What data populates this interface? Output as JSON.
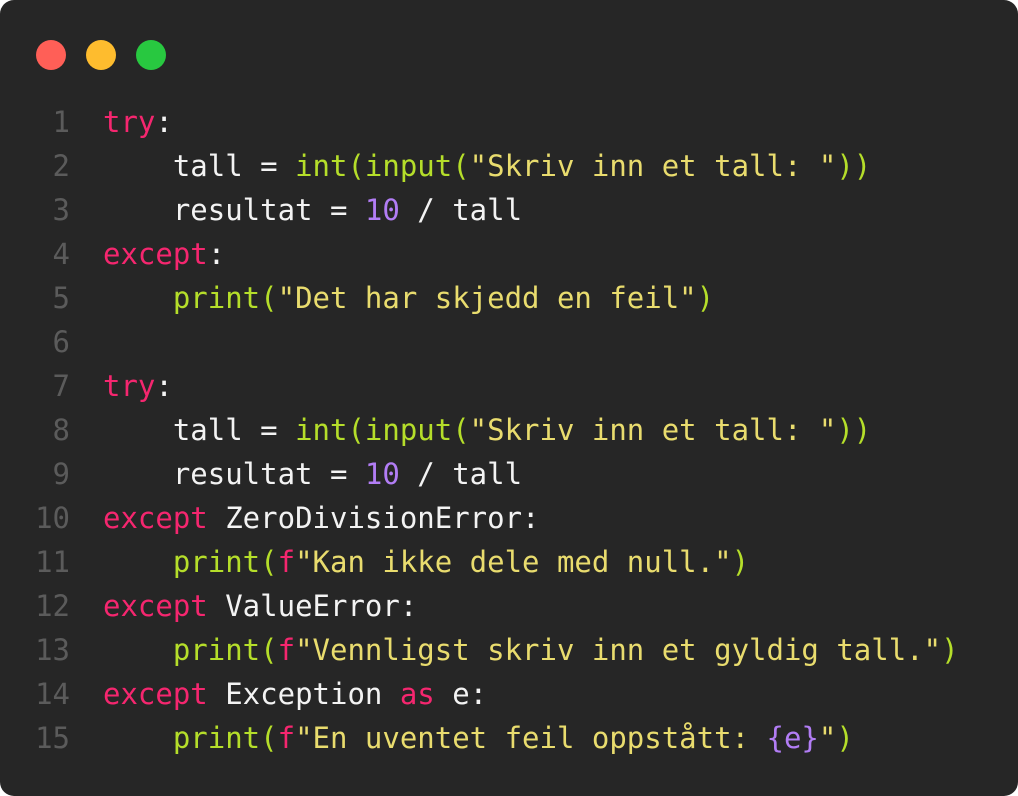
{
  "window": {
    "controls": [
      {
        "name": "close",
        "color": "#ff5f57"
      },
      {
        "name": "minimize",
        "color": "#febc2e"
      },
      {
        "name": "maximize",
        "color": "#28c840"
      }
    ]
  },
  "colors": {
    "background": "#262626",
    "keyword": "#f5266f",
    "function": "#b5de2a",
    "string": "#e9dc6e",
    "number": "#b27df5",
    "plain": "#f3f3f3",
    "line_number": "#5b5b5b"
  },
  "code": {
    "lines": [
      {
        "n": "1",
        "tokens": [
          {
            "t": "kw",
            "v": "try"
          },
          {
            "t": "pl",
            "v": ":"
          }
        ]
      },
      {
        "n": "2",
        "tokens": [
          {
            "t": "pl",
            "v": "    tall = "
          },
          {
            "t": "fn",
            "v": "int(input("
          },
          {
            "t": "str",
            "v": "\"Skriv inn et tall: \""
          },
          {
            "t": "fn",
            "v": "))"
          }
        ]
      },
      {
        "n": "3",
        "tokens": [
          {
            "t": "pl",
            "v": "    resultat = "
          },
          {
            "t": "num",
            "v": "10"
          },
          {
            "t": "pl",
            "v": " / tall"
          }
        ]
      },
      {
        "n": "4",
        "tokens": [
          {
            "t": "kw",
            "v": "except"
          },
          {
            "t": "pl",
            "v": ":"
          }
        ]
      },
      {
        "n": "5",
        "tokens": [
          {
            "t": "pl",
            "v": "    "
          },
          {
            "t": "fn",
            "v": "print("
          },
          {
            "t": "str",
            "v": "\"Det har skjedd en feil\""
          },
          {
            "t": "fn",
            "v": ")"
          }
        ]
      },
      {
        "n": "6",
        "tokens": []
      },
      {
        "n": "7",
        "tokens": [
          {
            "t": "kw",
            "v": "try"
          },
          {
            "t": "pl",
            "v": ":"
          }
        ]
      },
      {
        "n": "8",
        "tokens": [
          {
            "t": "pl",
            "v": "    tall = "
          },
          {
            "t": "fn",
            "v": "int(input("
          },
          {
            "t": "str",
            "v": "\"Skriv inn et tall: \""
          },
          {
            "t": "fn",
            "v": "))"
          }
        ]
      },
      {
        "n": "9",
        "tokens": [
          {
            "t": "pl",
            "v": "    resultat = "
          },
          {
            "t": "num",
            "v": "10"
          },
          {
            "t": "pl",
            "v": " / tall"
          }
        ]
      },
      {
        "n": "10",
        "tokens": [
          {
            "t": "kw",
            "v": "except"
          },
          {
            "t": "pl",
            "v": " ZeroDivisionError:"
          }
        ]
      },
      {
        "n": "11",
        "tokens": [
          {
            "t": "pl",
            "v": "    "
          },
          {
            "t": "fn",
            "v": "print("
          },
          {
            "t": "kw",
            "v": "f"
          },
          {
            "t": "str",
            "v": "\"Kan ikke dele med null.\""
          },
          {
            "t": "fn",
            "v": ")"
          }
        ]
      },
      {
        "n": "12",
        "tokens": [
          {
            "t": "kw",
            "v": "except"
          },
          {
            "t": "pl",
            "v": " ValueError:"
          }
        ]
      },
      {
        "n": "13",
        "tokens": [
          {
            "t": "pl",
            "v": "    "
          },
          {
            "t": "fn",
            "v": "print("
          },
          {
            "t": "kw",
            "v": "f"
          },
          {
            "t": "str",
            "v": "\"Vennligst skriv inn et gyldig tall.\""
          },
          {
            "t": "fn",
            "v": ")"
          }
        ]
      },
      {
        "n": "14",
        "tokens": [
          {
            "t": "kw",
            "v": "except"
          },
          {
            "t": "pl",
            "v": " Exception "
          },
          {
            "t": "kw",
            "v": "as"
          },
          {
            "t": "pl",
            "v": " e:"
          }
        ]
      },
      {
        "n": "15",
        "tokens": [
          {
            "t": "pl",
            "v": "    "
          },
          {
            "t": "fn",
            "v": "print("
          },
          {
            "t": "kw",
            "v": "f"
          },
          {
            "t": "str",
            "v": "\"En uventet feil oppstått: "
          },
          {
            "t": "num",
            "v": "{e}"
          },
          {
            "t": "str",
            "v": "\""
          },
          {
            "t": "fn",
            "v": ")"
          }
        ]
      }
    ]
  }
}
